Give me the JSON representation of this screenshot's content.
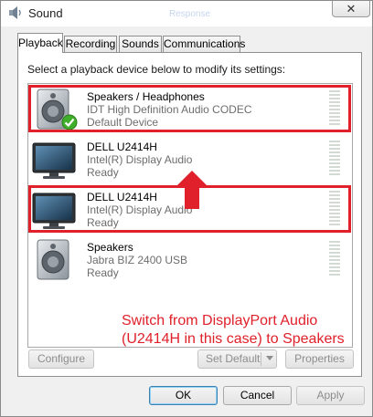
{
  "window": {
    "title": "Sound",
    "ghost_title": "Response",
    "close_glyph": "✕"
  },
  "tabs": [
    {
      "label": "Playback",
      "active": true
    },
    {
      "label": "Recording",
      "active": false
    },
    {
      "label": "Sounds",
      "active": false
    },
    {
      "label": "Communications",
      "active": false
    }
  ],
  "instruction": "Select a playback device below to modify its settings:",
  "devices": [
    {
      "name": "Speakers / Headphones",
      "description": "IDT High Definition Audio CODEC",
      "status": "Default Device",
      "icon": "speaker-icon",
      "default_check": true,
      "highlighted": true
    },
    {
      "name": "DELL U2414H",
      "description": "Intel(R) Display Audio",
      "status": "Ready",
      "icon": "monitor-icon",
      "default_check": false,
      "highlighted": false
    },
    {
      "name": "DELL U2414H",
      "description": "Intel(R) Display Audio",
      "status": "Ready",
      "icon": "monitor-icon",
      "default_check": false,
      "highlighted": true
    },
    {
      "name": "Speakers",
      "description": "Jabra BIZ 2400 USB",
      "status": "Ready",
      "icon": "speaker-icon",
      "default_check": false,
      "highlighted": false
    }
  ],
  "annotation": {
    "text_line1": "Switch from DisplayPort Audio",
    "text_line2": "(U2414H in this case) to Speakers",
    "color": "#e0202a"
  },
  "panel_buttons": {
    "configure": "Configure",
    "set_default": "Set Default",
    "properties": "Properties"
  },
  "dialog_buttons": {
    "ok": "OK",
    "cancel": "Cancel",
    "apply": "Apply"
  }
}
